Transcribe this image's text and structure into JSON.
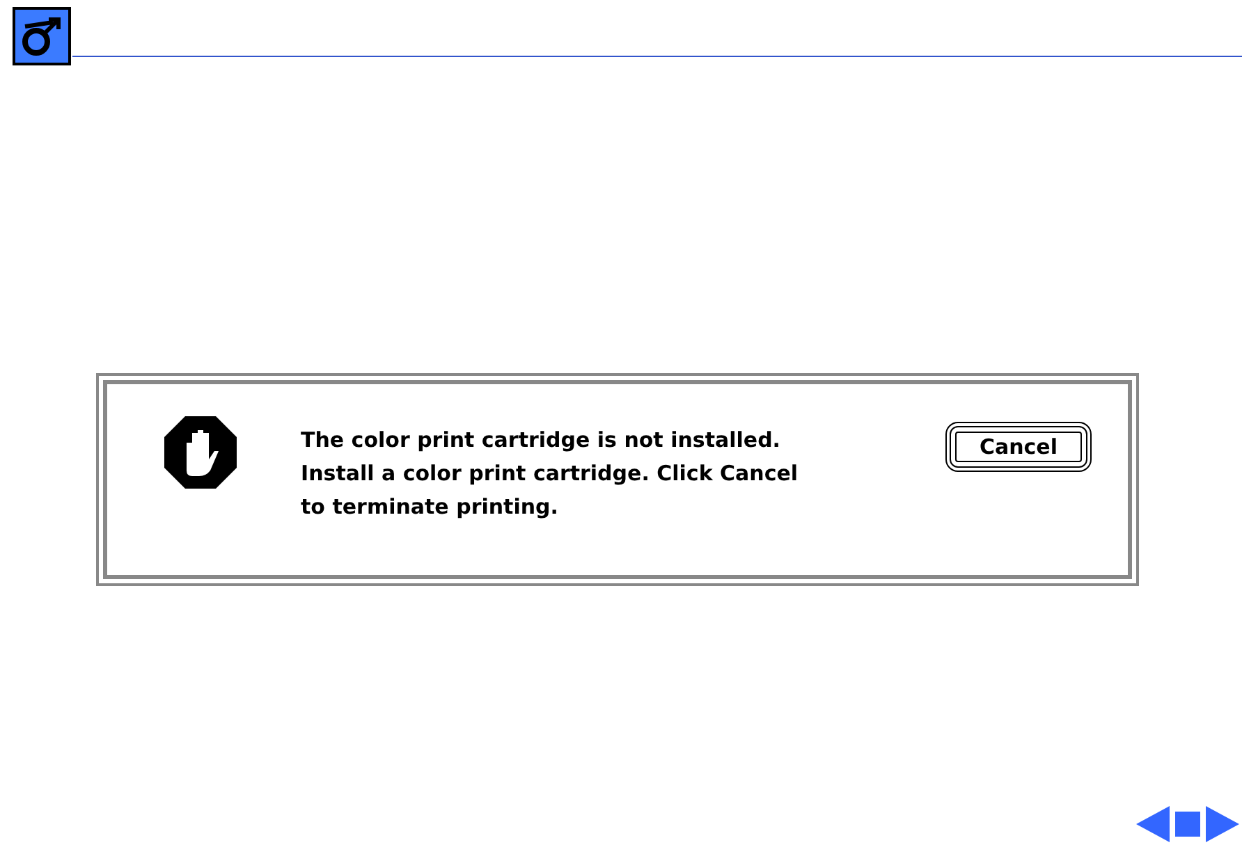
{
  "alert": {
    "message_lines": [
      "The color print cartridge is not installed.",
      "Install a color print cartridge. Click Cancel",
      "to terminate printing."
    ],
    "buttons": [
      {
        "label": "Cancel",
        "default": true
      }
    ]
  }
}
